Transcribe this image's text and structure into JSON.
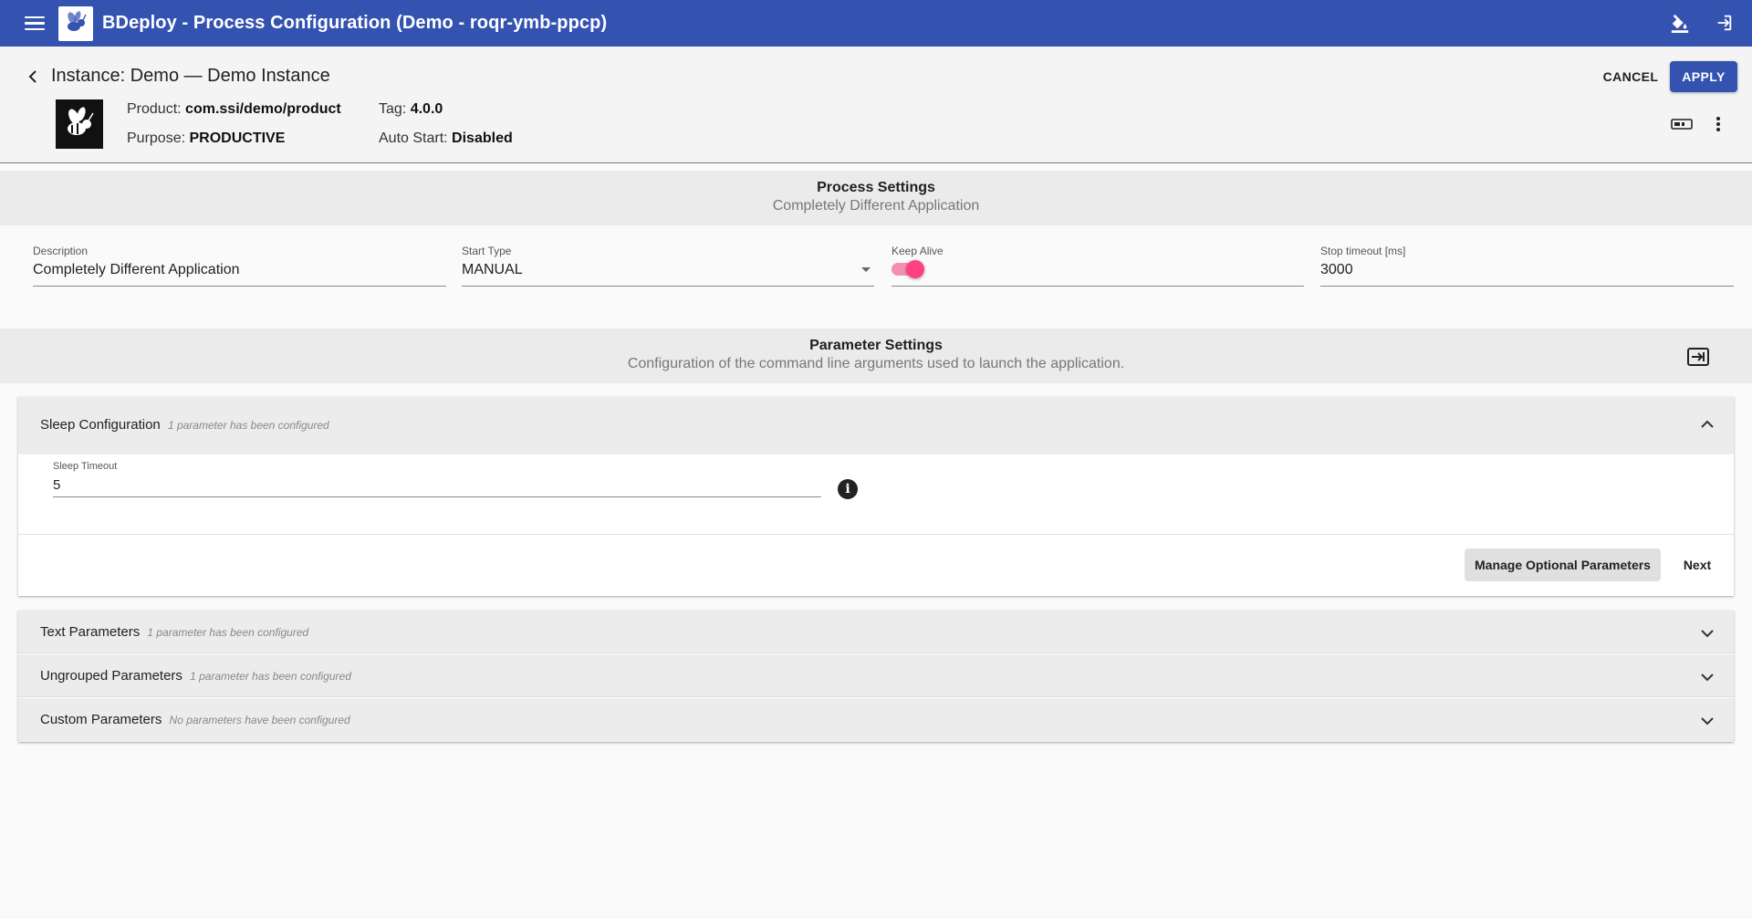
{
  "app": {
    "title": "BDeploy - Process Configuration (Demo - roqr-ymb-ppcp)"
  },
  "header": {
    "instance_title": "Instance: Demo — Demo Instance",
    "cancel_label": "CANCEL",
    "apply_label": "APPLY",
    "product_label": "Product:",
    "product_value": "com.ssi/demo/product",
    "tag_label": "Tag:",
    "tag_value": "4.0.0",
    "purpose_label": "Purpose:",
    "purpose_value": "PRODUCTIVE",
    "autostart_label": "Auto Start:",
    "autostart_value": "Disabled"
  },
  "process_settings": {
    "title": "Process Settings",
    "subtitle": "Completely Different Application",
    "fields": {
      "description": {
        "label": "Description",
        "value": "Completely Different Application"
      },
      "start_type": {
        "label": "Start Type",
        "value": "MANUAL"
      },
      "keep_alive": {
        "label": "Keep Alive",
        "enabled": true
      },
      "stop_timeout": {
        "label": "Stop timeout [ms]",
        "value": "3000"
      }
    }
  },
  "parameter_settings": {
    "title": "Parameter Settings",
    "subtitle": "Configuration of the command line arguments used to launch the application."
  },
  "groups": [
    {
      "title": "Sleep Configuration",
      "desc": "1 parameter has been configured",
      "expanded": true
    },
    {
      "title": "Text Parameters",
      "desc": "1 parameter has been configured",
      "expanded": false
    },
    {
      "title": "Ungrouped Parameters",
      "desc": "1 parameter has been configured",
      "expanded": false
    },
    {
      "title": "Custom Parameters",
      "desc": "No parameters have been configured",
      "expanded": false
    }
  ],
  "sleep_param": {
    "label": "Sleep Timeout",
    "value": "5"
  },
  "actions": {
    "manage_optional": "Manage Optional Parameters",
    "next": "Next"
  },
  "icons": [
    "menu-icon",
    "bee-logo-icon",
    "theme-paint-icon",
    "logout-icon",
    "chevron-left-icon",
    "process-port-icon",
    "more-vert-icon",
    "import-parameters-icon",
    "info-icon",
    "chevron-up-icon",
    "chevron-down-icon"
  ],
  "colors": {
    "primary": "#3452b0",
    "accent": "#ff4081",
    "band": "#ebebeb"
  }
}
